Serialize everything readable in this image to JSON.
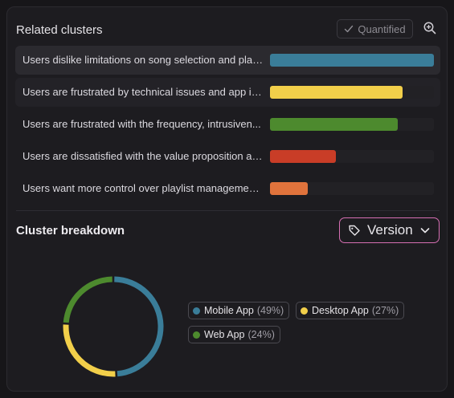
{
  "header": {
    "title": "Related clusters",
    "quantified_label": "Quantified"
  },
  "clusters": [
    {
      "label": "Users dislike limitations on song selection and play...",
      "value": 100,
      "color": "#3a7d99"
    },
    {
      "label": "Users are frustrated by technical issues and app in...",
      "value": 81,
      "color": "#f2cf4a"
    },
    {
      "label": "Users are frustrated with the frequency, intrusiven...",
      "value": 78,
      "color": "#4d8a2e"
    },
    {
      "label": "Users are dissatisfied with the value proposition an...",
      "value": 40,
      "color": "#c93d27"
    },
    {
      "label": "Users want more control over playlist management...",
      "value": 23,
      "color": "#e0733c"
    }
  ],
  "breakdown": {
    "title": "Cluster breakdown",
    "dropdown_label": "Version"
  },
  "chart_data": {
    "type": "pie",
    "categories": [
      "Mobile App",
      "Desktop App",
      "Web App"
    ],
    "values": [
      49,
      27,
      24
    ],
    "colors": [
      "#3a7d99",
      "#f2cf4a",
      "#4d8a2e"
    ],
    "percent_labels": [
      "(49%)",
      "(27%)",
      "(24%)"
    ],
    "donut": true
  }
}
